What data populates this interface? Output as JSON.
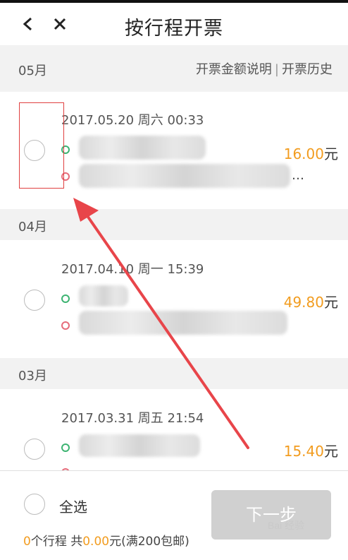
{
  "header": {
    "title": "按行程开票",
    "back_icon": "back-chevron-icon",
    "close_icon": "close-icon"
  },
  "head_links": {
    "amount_explain": "开票金额说明",
    "separator": "|",
    "history": "开票历史"
  },
  "sections": [
    {
      "month": "05月",
      "trips": [
        {
          "datetime": "2017.05.20 周六 00:33",
          "end_tail": "…",
          "price": "16.00",
          "unit": "元"
        }
      ]
    },
    {
      "month": "04月",
      "trips": [
        {
          "datetime": "2017.04.10 周一 15:39",
          "end_tail": "",
          "price": "49.80",
          "unit": "元"
        }
      ]
    },
    {
      "month": "03月",
      "trips": [
        {
          "datetime": "2017.03.31 周五 21:54",
          "end_tail": "",
          "price": "15.40",
          "unit": "元"
        }
      ]
    }
  ],
  "footer": {
    "select_all": "全选",
    "count": "0",
    "count_suffix": "个行程 共",
    "amount": "0.00",
    "amount_suffix": "元(满200包邮)",
    "next_button": "下一步"
  },
  "watermark": "Bai 经验",
  "colors": {
    "accent": "#f29c1f",
    "start_dot": "#3cb371",
    "end_dot": "#e66b7a",
    "annotation": "#e04040"
  }
}
